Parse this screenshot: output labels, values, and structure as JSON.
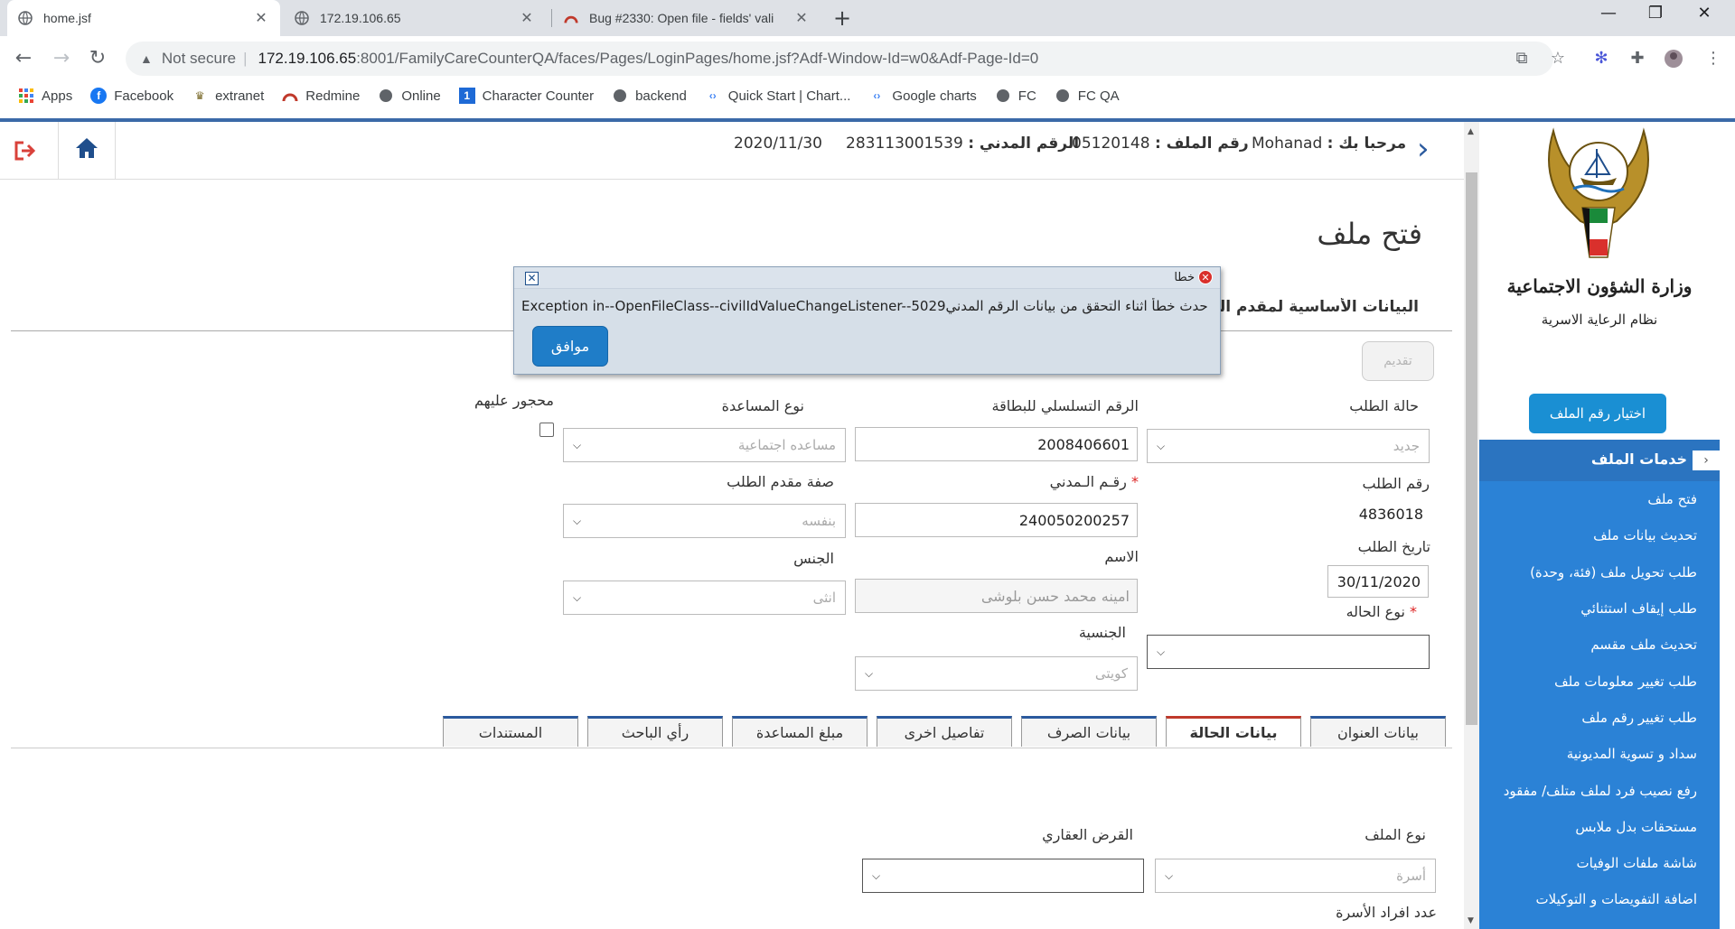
{
  "browser": {
    "tabs": [
      {
        "title": "home.jsf",
        "active": true
      },
      {
        "title": "172.19.106.65",
        "active": false
      },
      {
        "title": "Bug #2330: Open file - fields' vali",
        "active": false
      }
    ],
    "security_label": "Not secure",
    "url_host": "172.19.106.65",
    "url_path": ":8001/FamilyCareCounterQA/faces/Pages/LoginPages/home.jsf?Adf-Window-Id=w0&Adf-Page-Id=0",
    "bookmarks": [
      "Apps",
      "Facebook",
      "extranet",
      "Redmine",
      "Online",
      "Character Counter",
      "backend",
      "Quick Start | Chart...",
      "Google charts",
      "FC",
      "FC QA"
    ]
  },
  "header": {
    "welcome_label": "مرحبا بك :",
    "user_name": "Mohanad",
    "file_no_label": "رقم الملف :",
    "file_no": "05120148",
    "civil_id_label": "الرقم المدني :",
    "civil_id": "283113001539",
    "date": "2020/11/30"
  },
  "sidebar": {
    "ministry": "وزارة الشؤون الاجتماعية",
    "system": "نظام الرعاية الاسرية",
    "choose_file_button": "اختيار رقم الملف",
    "services_title": "خدمات الملف",
    "services": [
      "فتح ملف",
      "تحديث بيانات ملف",
      "طلب تحويل ملف (فئة، وحدة)",
      "طلب إيقاف استثنائي",
      "تحديث ملف مقسم",
      "طلب تغيير معلومات ملف",
      "طلب تغيير رقم ملف",
      "سداد و تسوية المديونية",
      "رفع نصيب فرد لملف متلف/ مفقود",
      "مستحقات بدل ملابس",
      "شاشة ملفات الوفيات",
      "اضافة التفويضات و التوكيلات"
    ]
  },
  "form": {
    "page_title": "فتح ملف",
    "section_title": "البيانات الأساسية لمقدم الطلب",
    "submit_button": "تقديم",
    "request_status_label": "حالة الطلب",
    "request_status_value": "جديد",
    "card_serial_label": "الرقم التسلسلي للبطاقة",
    "card_serial_value": "2008406601",
    "aid_type_label": "نوع المساعدة",
    "aid_type_value": "مساعده اجتماعية",
    "interdicted_label": "محجور عليهم",
    "request_no_label": "رقم الطلب",
    "request_no_value": "4836018",
    "civil_no_label": "رقـم الـمدني",
    "civil_no_value": "240050200257",
    "applicant_capacity_label": "صفة مقدم الطلب",
    "applicant_capacity_value": "بنفسه",
    "request_date_label": "تاريخ الطلب",
    "request_date_value": "30/11/2020",
    "name_label": "الاسم",
    "name_value": "امينه محمد حسن بلوشى",
    "gender_label": "الجنس",
    "gender_value": "انثى",
    "case_type_label": "نوع الحاله",
    "nationality_label": "الجنسية",
    "nationality_value": "كويتى",
    "tabs": [
      "بيانات العنوان",
      "بيانات الحالة",
      "بيانات الصرف",
      "تفاصيل اخرى",
      "مبلغ المساعدة",
      "رأي الباحث",
      "المستندات"
    ],
    "file_type_label": "نوع الملف",
    "file_type_value": "أسرة",
    "housing_loan_label": "القرض العقاري",
    "family_count_label": "عدد افراد الأسرة"
  },
  "dialog": {
    "title": "خطا",
    "message": "Exception in--OpenFileClass--civilIdValueChangeListener--5029لقد حدث خطأ اثناء التحقق من بيانات الرقم المدني",
    "ok_button": "موافق"
  },
  "colors": {
    "accent": "#2b82d6",
    "header_bar": "#3b6aa8",
    "dialog_bg": "#d6dfe8",
    "button_blue": "#1f7dc8"
  }
}
